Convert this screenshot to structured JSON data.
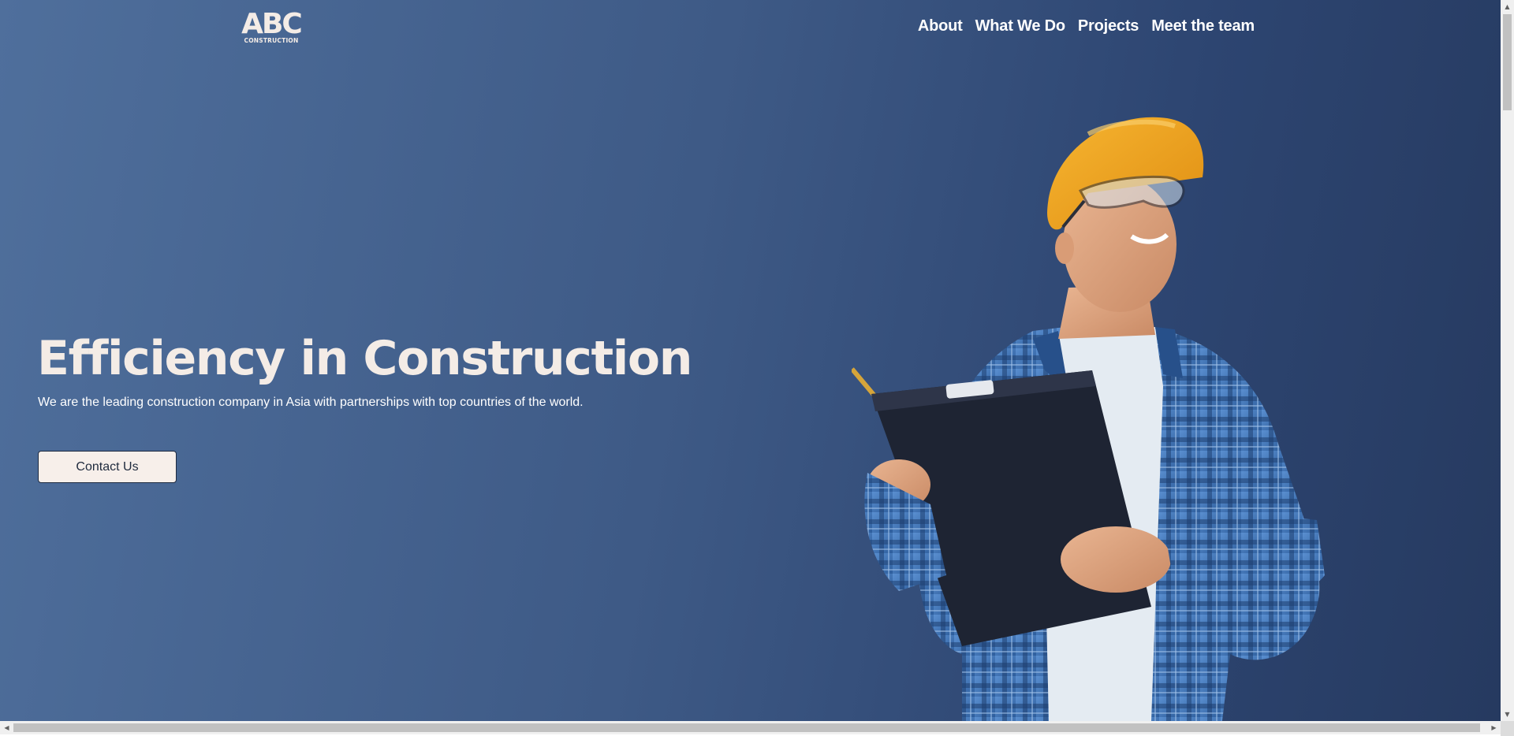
{
  "logo": {
    "main": "ABC",
    "sub": "CONSTRUCTION"
  },
  "nav": {
    "items": [
      "About",
      "What We Do",
      "Projects",
      "Meet the team"
    ]
  },
  "hero": {
    "title": "Efficiency in Construction",
    "subtitle": "We are the leading construction company in Asia with partnerships with top countries of the world.",
    "cta_label": "Contact Us"
  },
  "colors": {
    "background_start": "#4f6f9c",
    "background_end": "#263a60",
    "text_light": "#f4ece6",
    "button_bg": "#f7efea"
  },
  "icons": {
    "scroll_up": "▲",
    "scroll_down": "▼",
    "scroll_left": "◀",
    "scroll_right": "▶"
  }
}
